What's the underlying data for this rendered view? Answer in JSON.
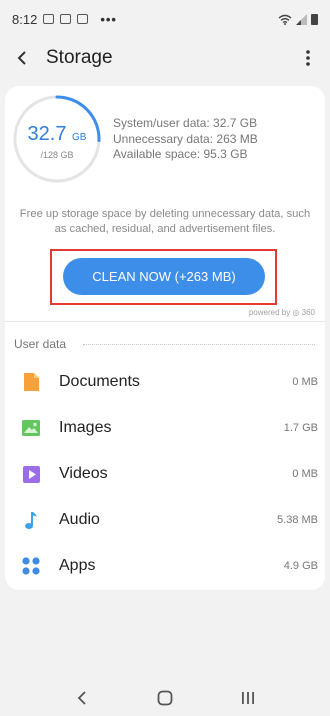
{
  "status_bar": {
    "time": "8:12",
    "more_indicator": "•••",
    "icons": [
      "image-notification-icon",
      "gallery-notification-icon",
      "mail-notification-icon",
      "wifi-icon",
      "signal-icon",
      "battery-icon"
    ]
  },
  "app_bar": {
    "title": "Storage"
  },
  "summary": {
    "used_value": "32.7",
    "used_unit": "GB",
    "total": "/128 GB",
    "used_fraction": 0.2555,
    "system_user_data": "System/user data: 32.7 GB",
    "unnecessary_data": "Unnecessary data: 263 MB",
    "available_space": "Available space: 95.3 GB",
    "ring_color": "#3d8ee8"
  },
  "description": "Free up storage space by deleting unnecessary data, such as cached, residual, and advertisement files.",
  "clean_button": {
    "label": "CLEAN NOW (+263 MB)",
    "color": "#3d8ee8"
  },
  "powered_by": "powered by ◎ 360",
  "user_data": {
    "header": "User data",
    "items": [
      {
        "label": "Documents",
        "value": "0 MB",
        "icon": "documents-icon",
        "color": "#f7a13b"
      },
      {
        "label": "Images",
        "value": "1.7 GB",
        "icon": "images-icon",
        "color": "#63c75e"
      },
      {
        "label": "Videos",
        "value": "0 MB",
        "icon": "videos-icon",
        "color": "#9b6ee8"
      },
      {
        "label": "Audio",
        "value": "5.38 MB",
        "icon": "audio-icon",
        "color": "#3fa2e8"
      },
      {
        "label": "Apps",
        "value": "4.9 GB",
        "icon": "apps-icon",
        "color": "#3f8be3"
      }
    ]
  },
  "nav_bar": {
    "icons": [
      "back-nav-icon",
      "home-nav-icon",
      "recents-nav-icon"
    ]
  }
}
